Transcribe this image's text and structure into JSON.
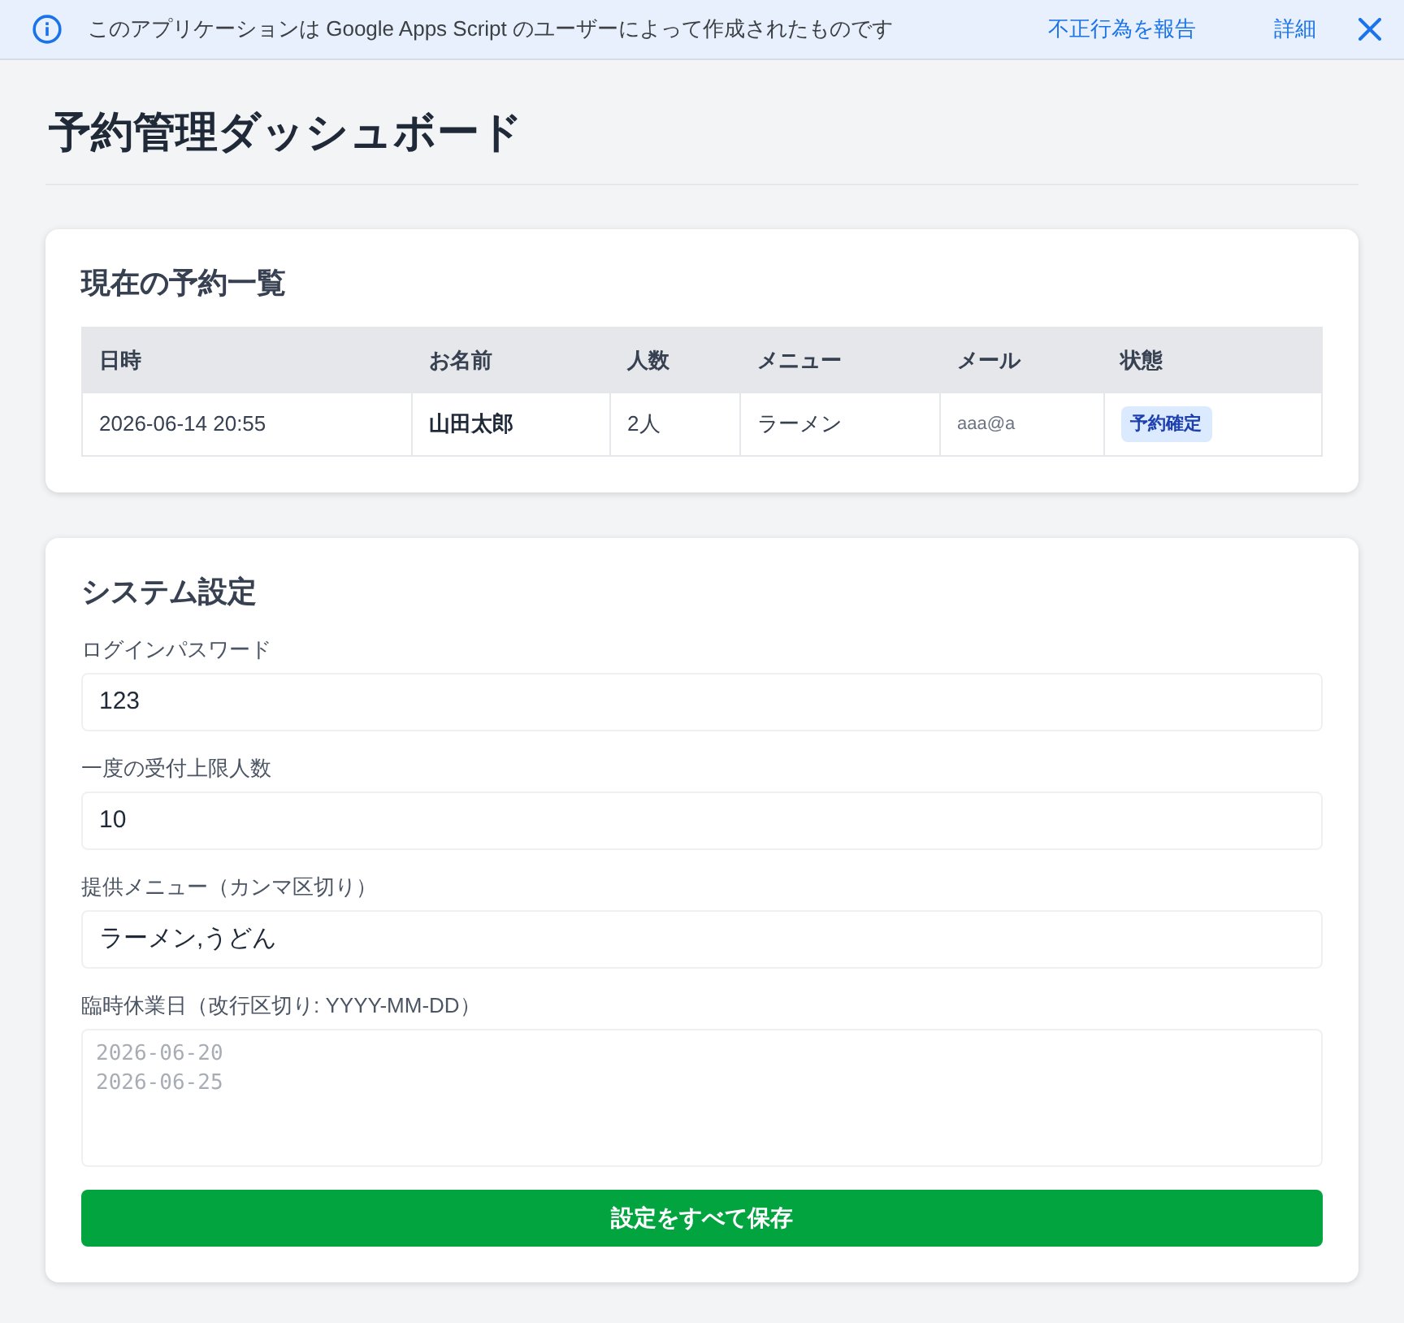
{
  "banner": {
    "message": "このアプリケーションは Google Apps Script のユーザーによって作成されたものです",
    "links": [
      "不正行為を報告",
      "詳細"
    ]
  },
  "page_title": "予約管理ダッシュボード",
  "reservations": {
    "title": "現在の予約一覧",
    "columns": [
      "日時",
      "お名前",
      "人数",
      "メニュー",
      "メール",
      "状態"
    ],
    "rows": [
      {
        "datetime": "2026-06-14 20:55",
        "name": "山田太郎",
        "party": "2人",
        "menu": "ラーメン",
        "email": "aaa@a",
        "status": "予約確定"
      }
    ]
  },
  "settings": {
    "title": "システム設定",
    "fields": [
      {
        "kind": "input",
        "label": "ログインパスワード",
        "value": "123"
      },
      {
        "kind": "input",
        "label": "一度の受付上限人数",
        "value": "10"
      },
      {
        "kind": "input",
        "label": "提供メニュー（カンマ区切り）",
        "value": "ラーメン,うどん"
      },
      {
        "kind": "textarea",
        "label": "臨時休業日（改行区切り: YYYY-MM-DD）",
        "placeholder": "2026-06-20\n2026-06-25"
      }
    ],
    "save_button": "設定をすべて保存"
  }
}
